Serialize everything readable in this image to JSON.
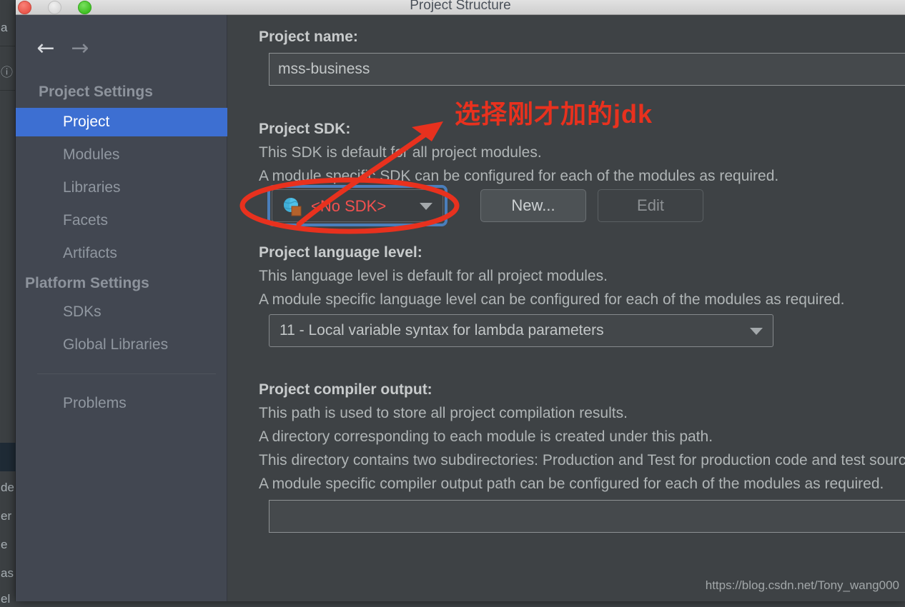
{
  "window": {
    "title": "Project Structure",
    "traffic_lights": [
      "close-button",
      "minimize-button",
      "zoom-button"
    ]
  },
  "background_strip": {
    "rows": [
      "a",
      "",
      "",
      "",
      "",
      "de",
      "er",
      "e",
      "as",
      "el"
    ],
    "icon": "ⓘ"
  },
  "sidebar": {
    "back_arrow": "←",
    "forward_arrow": "→",
    "groups": [
      {
        "label": "Project Settings",
        "items": [
          {
            "label": "Project",
            "selected": true
          },
          {
            "label": "Modules",
            "selected": false
          },
          {
            "label": "Libraries",
            "selected": false
          },
          {
            "label": "Facets",
            "selected": false
          },
          {
            "label": "Artifacts",
            "selected": false
          }
        ]
      },
      {
        "label": "Platform Settings",
        "items": [
          {
            "label": "SDKs",
            "selected": false
          },
          {
            "label": "Global Libraries",
            "selected": false
          }
        ]
      }
    ],
    "extra_items": [
      {
        "label": "Problems",
        "selected": false
      }
    ]
  },
  "main": {
    "project_name": {
      "label": "Project name:",
      "value": "mss-business"
    },
    "project_sdk": {
      "label": "Project SDK:",
      "desc1": "This SDK is default for all project modules.",
      "desc2": "A module specific SDK can be configured for each of the modules as required.",
      "selected": "<No SDK>",
      "icon": "globe-sdk-icon",
      "new_button": "New...",
      "edit_button": "Edit"
    },
    "project_language_level": {
      "label": "Project language level:",
      "desc1": "This language level is default for all project modules.",
      "desc2": "A module specific language level can be configured for each of the modules as required.",
      "selected": "11 - Local variable syntax for lambda parameters"
    },
    "project_compiler_output": {
      "label": "Project compiler output:",
      "desc1": "This path is used to store all project compilation results.",
      "desc2": "A directory corresponding to each module is created under this path.",
      "desc3": "This directory contains two subdirectories: Production and Test for production code and test sources, respectively.",
      "desc4": "A module specific compiler output path can be configured for each of the modules as required.",
      "value": ""
    }
  },
  "annotations": {
    "callout_text": "选择刚才加的jdk",
    "callout_color": "#e8311e",
    "ellipse_target": "project-sdk-combo"
  },
  "watermark": {
    "url": "https://blog.csdn.net/Tony_wang000"
  },
  "colors": {
    "sidebar_bg": "#424751",
    "main_bg": "#3e4245",
    "selection": "#3d6fd2",
    "focus_ring": "#4a7ebb",
    "annotation_red": "#e8311e",
    "sdk_missing_red": "#f4514f"
  }
}
